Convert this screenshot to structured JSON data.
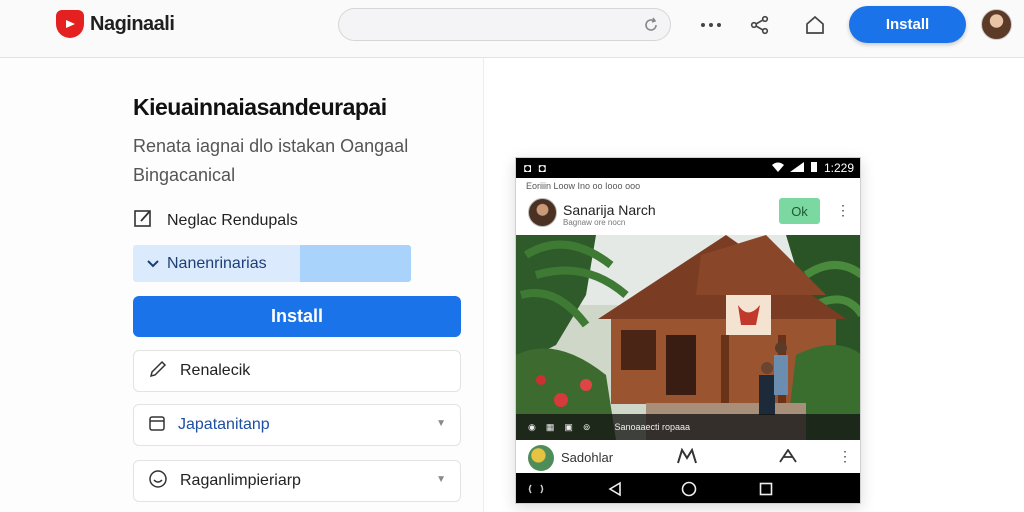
{
  "header": {
    "brand": "Naginaali",
    "install_label": "Install"
  },
  "main": {
    "title": "Kieuainnaiasandeurapai",
    "subtitle": "Renata iagnai dlo istakan Oangaal Bingacanical",
    "edit_label": "Neglac Rendupals",
    "select_label": "Nanenrinarias",
    "install_label": "Install",
    "options": [
      {
        "label": "Renalecik",
        "icon": "pencil-icon"
      },
      {
        "label": "Japatanitanp",
        "icon": "box-icon"
      },
      {
        "label": "Raganlimpieriarp",
        "icon": "smiley-icon"
      }
    ]
  },
  "phone": {
    "status_left": "◘ ◘",
    "status_time": "1:229",
    "notif": "Eoriiin Loow Ino oo Iooo ooo",
    "post": {
      "name": "Sanarija Narch",
      "sub": "Bagnaw ore nocn",
      "ok_label": "Ok",
      "caption": "Sanoaaecti ropaaa"
    },
    "comment_name": "Sadohlar"
  },
  "colors": {
    "accent": "#1a73e8",
    "brand_red": "#e52020",
    "ok_green": "#7ad8a0"
  }
}
